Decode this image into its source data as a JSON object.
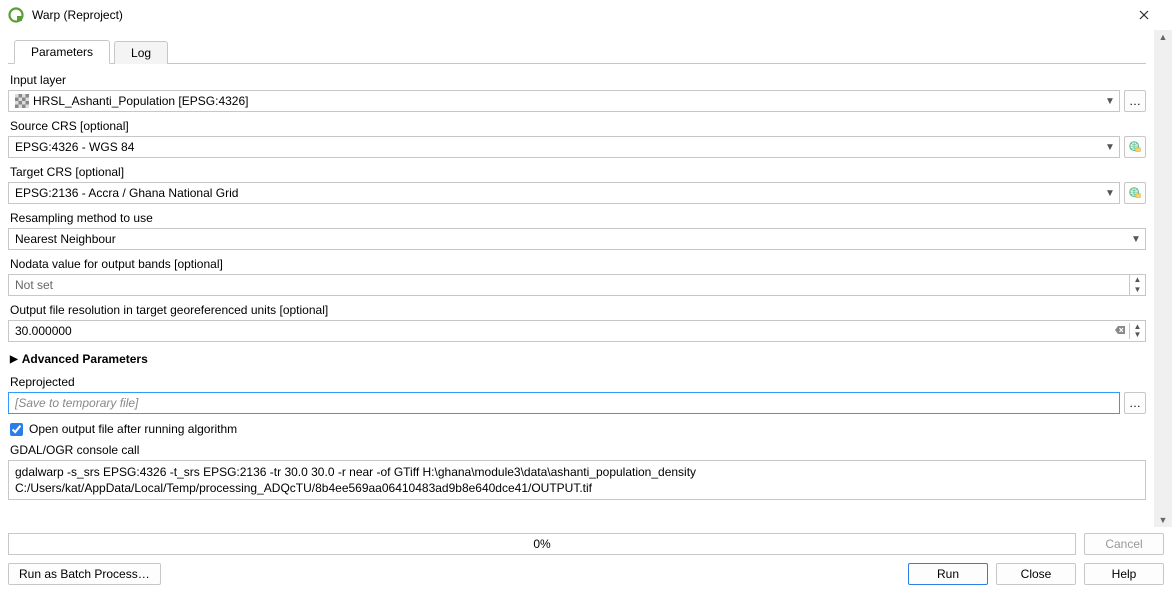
{
  "window": {
    "title": "Warp (Reproject)"
  },
  "tabs": {
    "parameters": "Parameters",
    "log": "Log"
  },
  "labels": {
    "input_layer": "Input layer",
    "source_crs": "Source CRS [optional]",
    "target_crs": "Target CRS [optional]",
    "resampling": "Resampling method to use",
    "nodata": "Nodata value for output bands [optional]",
    "ofr": "Output file resolution in target georeferenced units [optional]",
    "advanced": "Advanced Parameters",
    "reprojected": "Reprojected",
    "open_after": "Open output file after running algorithm",
    "console_call": "GDAL/OGR console call"
  },
  "values": {
    "input_layer": "HRSL_Ashanti_Population [EPSG:4326]",
    "source_crs": "EPSG:4326 - WGS 84",
    "target_crs": "EPSG:2136 - Accra / Ghana National Grid",
    "resampling": "Nearest Neighbour",
    "nodata": "Not set",
    "ofr": "30.000000",
    "reprojected_placeholder": "[Save to temporary file]",
    "console": "gdalwarp -s_srs EPSG:4326 -t_srs EPSG:2136 -tr 30.0 30.0 -r near -of GTiff H:\\ghana\\module3\\data\\ashanti_population_density C:/Users/kat/AppData/Local/Temp/processing_ADQcTU/8b4ee569aa06410483ad9b8e640dce41/OUTPUT.tif"
  },
  "footer": {
    "progress": "0%",
    "cancel": "Cancel",
    "batch": "Run as Batch Process…",
    "run": "Run",
    "close": "Close",
    "help": "Help"
  }
}
